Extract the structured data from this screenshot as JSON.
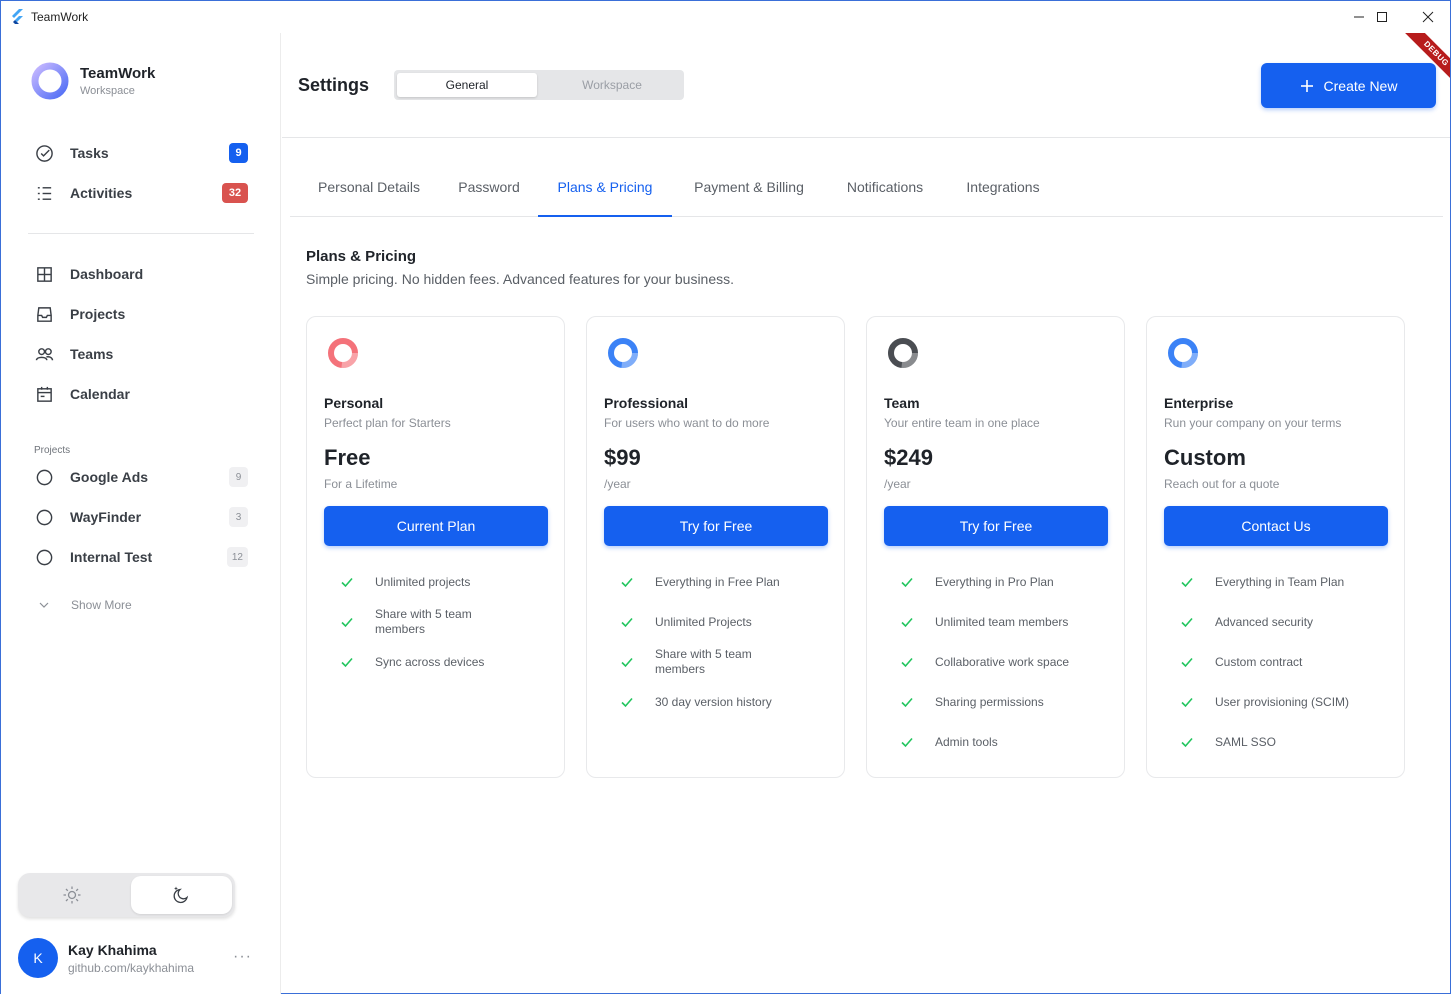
{
  "window": {
    "title": "TeamWork"
  },
  "brand": {
    "name": "TeamWork",
    "subtitle": "Workspace"
  },
  "sidebar": {
    "top_items": [
      {
        "label": "Tasks",
        "badge": "9"
      },
      {
        "label": "Activities",
        "badge": "32"
      }
    ],
    "main_items": [
      {
        "label": "Dashboard"
      },
      {
        "label": "Projects"
      },
      {
        "label": "Teams"
      },
      {
        "label": "Calendar"
      }
    ],
    "projects_label": "Projects",
    "projects": [
      {
        "label": "Google Ads",
        "count": "9"
      },
      {
        "label": "WayFinder",
        "count": "3"
      },
      {
        "label": "Internal Test",
        "count": "12"
      }
    ],
    "show_more": "Show More",
    "theme": {
      "selected": "dark"
    }
  },
  "user": {
    "initial": "K",
    "name": "Kay Khahima",
    "link": "github.com/kaykhahima",
    "more": "···"
  },
  "header": {
    "title": "Settings",
    "segments": [
      "General",
      "Workspace"
    ],
    "active_segment": "General",
    "create_label": "Create New",
    "debug_banner": "DEBUG"
  },
  "tabs": [
    "Personal Details",
    "Password",
    "Plans & Pricing",
    "Payment & Billing",
    "Notifications",
    "Integrations"
  ],
  "active_tab": "Plans & Pricing",
  "plans_section": {
    "title": "Plans & Pricing",
    "subtitle": "Simple pricing. No hidden fees. Advanced features for your business."
  },
  "plans": [
    {
      "name": "Personal",
      "description": "Perfect plan for Starters",
      "price": "Free",
      "period": "For a Lifetime",
      "cta": "Current Plan",
      "icon_color": "#f4727a",
      "features": [
        "Unlimited projects",
        "Share with 5 team members",
        "Sync across devices"
      ]
    },
    {
      "name": "Professional",
      "description": "For users who want to do more",
      "price": "$99",
      "period": "/year",
      "cta": "Try for Free",
      "icon_color": "#3b82f6",
      "features": [
        "Everything in Free Plan",
        "Unlimited Projects",
        "Share with 5 team members",
        "30 day version history"
      ]
    },
    {
      "name": "Team",
      "description": "Your entire team in one place",
      "price": "$249",
      "period": "/year",
      "cta": "Try for Free",
      "icon_color": "#4a4d52",
      "features": [
        "Everything in Pro Plan",
        "Unlimited team members",
        "Collaborative work space",
        "Sharing permissions",
        "Admin tools"
      ]
    },
    {
      "name": "Enterprise",
      "description": "Run your company on your terms",
      "price": "Custom",
      "period": "Reach out for a quote",
      "cta": "Contact Us",
      "icon_color": "#3b82f6",
      "features": [
        "Everything in Team Plan",
        "Advanced security",
        "Custom contract",
        "User provisioning (SCIM)",
        "SAML SSO"
      ]
    }
  ],
  "colors": {
    "accent": "#1560ef",
    "check": "#22c55e",
    "danger": "#d9534f"
  }
}
